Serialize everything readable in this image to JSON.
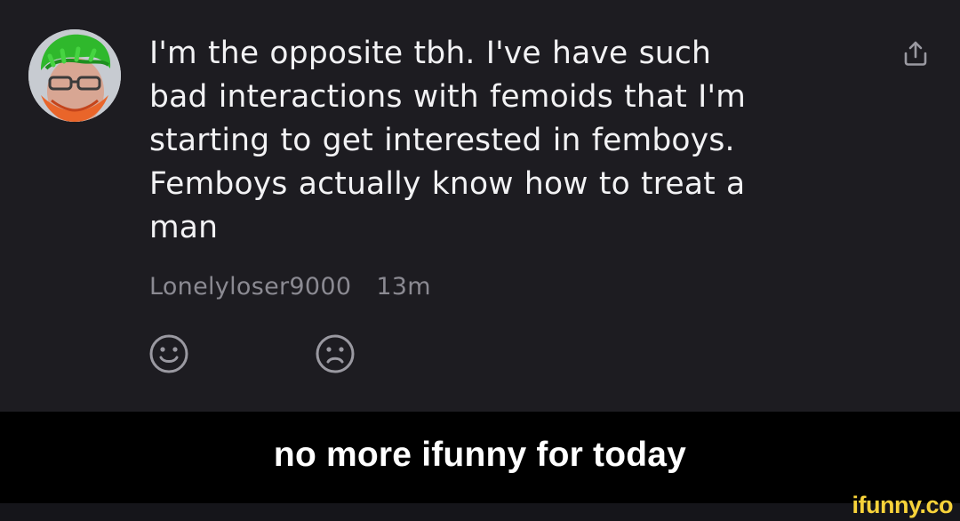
{
  "comment": {
    "text_lines": [
      "I'm the opposite tbh. I've have such",
      "bad interactions with femoids that I'm",
      "starting to get interested in femboys.",
      "Femboys actually know how to treat a",
      "man"
    ],
    "username": "Lonelyloser9000",
    "time": "13m",
    "avatar_icon": "user-avatar",
    "share_icon": "share-icon",
    "reactions": [
      {
        "name": "smile-reaction",
        "icon": "smile-icon"
      },
      {
        "name": "frown-reaction",
        "icon": "frown-icon"
      }
    ]
  },
  "caption": {
    "text": "no more ifunny for today"
  },
  "watermark": {
    "text": "ifunny.co"
  },
  "colors": {
    "background": "#1d1c21",
    "text": "#f2f2f4",
    "meta": "#8b8a92",
    "icon": "#9a99a1",
    "caption_bar": "#000000",
    "watermark": "#f8d33a"
  }
}
